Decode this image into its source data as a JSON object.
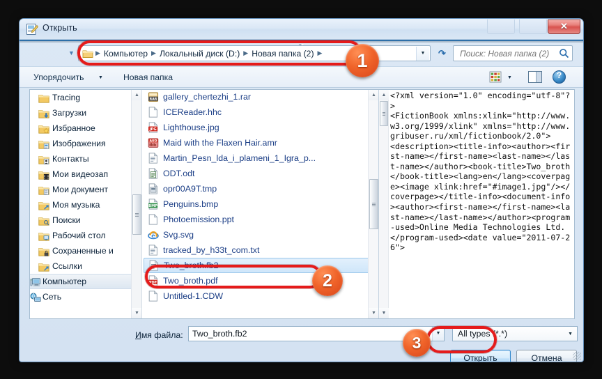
{
  "window": {
    "title": "Открыть",
    "title_icon": "open-file-icon",
    "close_label": "✕"
  },
  "nav": {
    "back_icon": "back-arrow-icon",
    "forward_icon": "forward-arrow-icon",
    "recent_icon": "recent-locations-icon",
    "refresh_icon": "refresh-icon",
    "breadcrumbs": [
      "Компьютер",
      "Локальный диск (D:)",
      "Новая папка (2)"
    ],
    "separator": "▸",
    "dropdown_icon": "chevron-down-icon"
  },
  "search": {
    "placeholder": "Поиск: Новая папка (2)",
    "value": "",
    "icon": "search-icon"
  },
  "toolbar": {
    "organize_label": "Упорядочить",
    "organize_caret": "▼",
    "new_folder_label": "Новая папка",
    "view_mode_icon": "view-mode-icon",
    "view_mode_caret": "▼",
    "preview_pane_icon": "preview-pane-icon",
    "help_icon": "help-icon"
  },
  "nav_pane": {
    "items": [
      {
        "label": "Tracing",
        "icon": "folder-icon",
        "level": 2,
        "selected": false
      },
      {
        "label": "Загрузки",
        "icon": "downloads-folder-icon",
        "level": 2,
        "selected": false
      },
      {
        "label": "Избранное",
        "icon": "favorites-folder-icon",
        "level": 2,
        "selected": false
      },
      {
        "label": "Изображения",
        "icon": "pictures-folder-icon",
        "level": 2,
        "selected": false
      },
      {
        "label": "Контакты",
        "icon": "contacts-folder-icon",
        "level": 2,
        "selected": false
      },
      {
        "label": "Мои видеозап",
        "icon": "videos-folder-icon",
        "level": 2,
        "selected": false
      },
      {
        "label": "Мои документ",
        "icon": "documents-folder-icon",
        "level": 2,
        "selected": false
      },
      {
        "label": "Моя музыка",
        "icon": "music-folder-icon",
        "level": 2,
        "selected": false
      },
      {
        "label": "Поиски",
        "icon": "searches-folder-icon",
        "level": 2,
        "selected": false
      },
      {
        "label": "Рабочий стол",
        "icon": "desktop-folder-icon",
        "level": 2,
        "selected": false
      },
      {
        "label": "Сохраненные и",
        "icon": "saved-games-folder-icon",
        "level": 2,
        "selected": false
      },
      {
        "label": "Ссылки",
        "icon": "links-folder-icon",
        "level": 2,
        "selected": false
      },
      {
        "label": "Компьютер",
        "icon": "computer-icon",
        "level": 1,
        "selected": true
      },
      {
        "label": "Сеть",
        "icon": "network-icon",
        "level": 1,
        "selected": false
      }
    ]
  },
  "file_pane": {
    "items": [
      {
        "label": "gallery_chertezhi_1.rar",
        "icon": "rar-archive-icon",
        "selected": false
      },
      {
        "label": "ICEReader.hhc",
        "icon": "generic-file-icon",
        "selected": false
      },
      {
        "label": "Lighthouse.jpg",
        "icon": "jpg-image-icon",
        "selected": false
      },
      {
        "label": "Maid with the Flaxen Hair.amr",
        "icon": "amr-audio-icon",
        "selected": false
      },
      {
        "label": "Martin_Pesn_lda_i_plameni_1_Igra_p...",
        "icon": "text-document-icon",
        "selected": false
      },
      {
        "label": "ODT.odt",
        "icon": "odt-document-icon",
        "selected": false
      },
      {
        "label": "opr00A9T.tmp",
        "icon": "tmp-file-icon",
        "selected": false
      },
      {
        "label": "Penguins.bmp",
        "icon": "bmp-image-icon",
        "selected": false
      },
      {
        "label": "Photoemission.ppt",
        "icon": "generic-file-icon",
        "selected": false
      },
      {
        "label": "Svg.svg",
        "icon": "svg-browser-icon",
        "selected": false
      },
      {
        "label": "tracked_by_h33t_com.txt",
        "icon": "text-document-icon",
        "selected": false
      },
      {
        "label": "Two_broth.fb2",
        "icon": "fb2-document-icon",
        "selected": true
      },
      {
        "label": "Two_broth.pdf",
        "icon": "pdf-document-icon",
        "selected": false
      },
      {
        "label": "Untitled-1.CDW",
        "icon": "generic-file-icon",
        "selected": false
      }
    ]
  },
  "preview": {
    "text": "<?xml version=\"1.0\" encoding=\"utf-8\"?>\n<FictionBook xmlns:xlink=\"http://www.w3.org/1999/xlink\" xmlns=\"http://www.gribuser.ru/xml/fictionbook/2.0\">\n<description><title-info><author><first-name></first-name><last-name></last-name></author><book-title>Two_broth</book-title><lang>en</lang><coverpage><image xlink:href=\"#image1.jpg\"/></coverpage></title-info><document-info><author><first-name></first-name><last-name></last-name></author><program-used>Online Media Technologies Ltd.</program-used><date value=\"2011-07-26\">"
  },
  "form": {
    "filename_label_accel": "И",
    "filename_label_rest": "мя файла:",
    "filename_value": "Two_broth.fb2",
    "filename_dropdown_icon": "chevron-down-icon",
    "filetype_value": "All types (*.*)",
    "filetype_caret": "▼",
    "open_label": "Открыть",
    "cancel_label": "Отмена"
  },
  "annotations": {
    "badges": [
      {
        "number": "1",
        "target": "address-bar"
      },
      {
        "number": "2",
        "target": "selected-file"
      },
      {
        "number": "3",
        "target": "open-button"
      }
    ],
    "highlight_color": "#e51b1b"
  }
}
